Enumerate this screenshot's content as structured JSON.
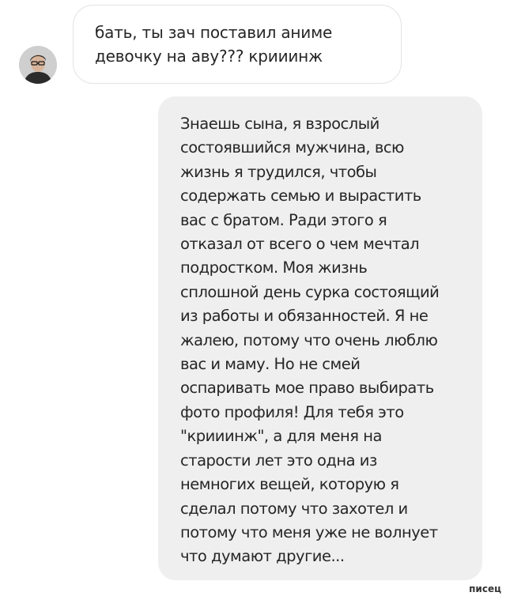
{
  "incoming_message": {
    "text": "бать, ты зач поставил аниме\nдевочку на аву??? крииинж"
  },
  "outgoing_message": {
    "text": "Знаешь сына, я взрослый\nсостоявшийся мужчина, всю\nжизнь я трудился, чтобы\nсодержать семью и вырастить\nвас с братом. Ради этого я\nотказал от всего о чем мечтал\nподростком. Моя жизнь\nсплошной день сурка состоящий\nиз работы и обязанностей. Я не\nжалею, потому что очень люблю\nвас и маму. Но не смей\nоспаривать мое право выбирать\nфото профиля! Для тебя это\n\"крииинж\", а для меня на\nстарости лет это одна из\nнемногих вещей, которую я\nсделал потому что захотел и\nпотому что меня уже не волнует\nчто думают другие..."
  },
  "watermark": {
    "text": "писец"
  },
  "colors": {
    "incoming_bubble_border": "#e3e3e3",
    "outgoing_bubble_bg": "#efefef",
    "text": "#262626"
  }
}
